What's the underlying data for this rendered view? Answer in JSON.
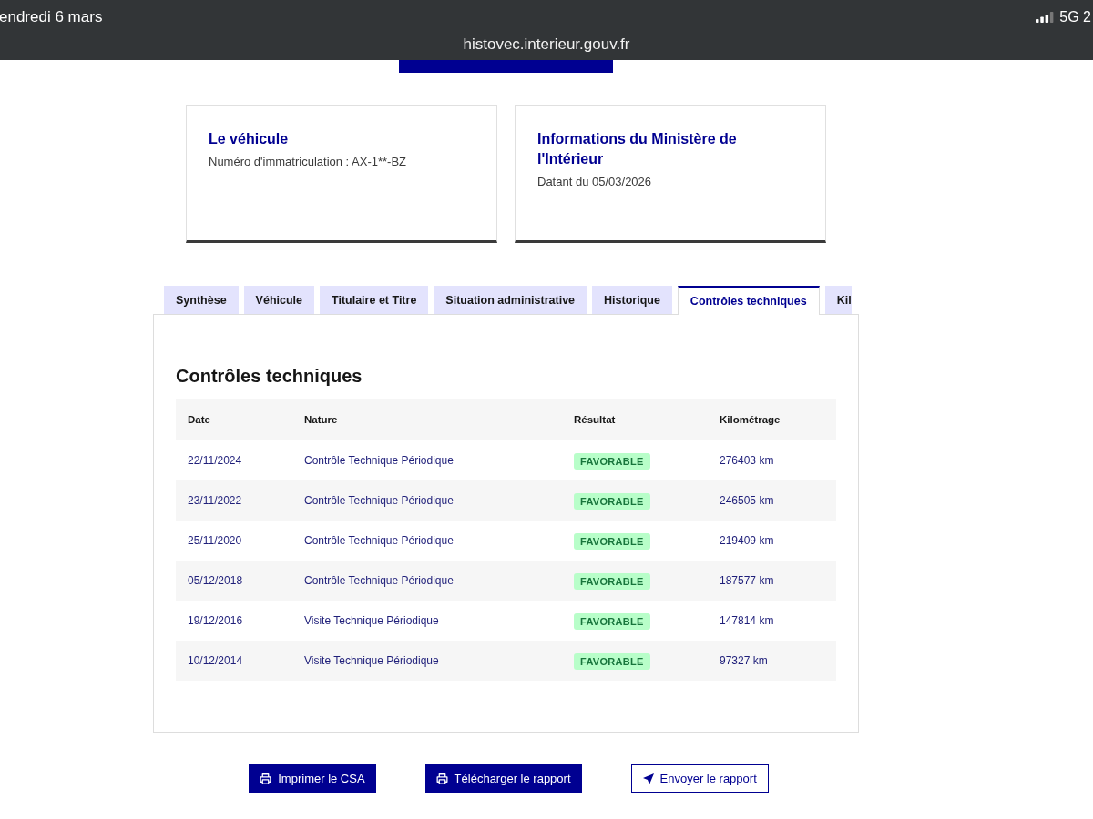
{
  "status_bar": {
    "date": "endredi 6 mars",
    "network": "5G 2",
    "url": "histovec.interieur.gouv.fr"
  },
  "cards": [
    {
      "title": "Le véhicule",
      "text": "Numéro d'immatriculation : AX-1**-BZ"
    },
    {
      "title": "Informations du Ministère de l'Intérieur",
      "text": "Datant du 05/03/2026"
    }
  ],
  "tabs": [
    {
      "label": "Synthèse",
      "selected": false
    },
    {
      "label": "Véhicule",
      "selected": false
    },
    {
      "label": "Titulaire et Titre",
      "selected": false
    },
    {
      "label": "Situation administrative",
      "selected": false
    },
    {
      "label": "Historique",
      "selected": false
    },
    {
      "label": "Contrôles techniques",
      "selected": true
    },
    {
      "label": "Kil",
      "selected": false
    }
  ],
  "panel": {
    "title": "Contrôles techniques",
    "table": {
      "columns": [
        "Date",
        "Nature",
        "Résultat",
        "Kilométrage"
      ],
      "rows": [
        {
          "date": "22/11/2024",
          "nature": "Contrôle Technique Périodique",
          "result": "FAVORABLE",
          "mileage": "276403 km"
        },
        {
          "date": "23/11/2022",
          "nature": "Contrôle Technique Périodique",
          "result": "FAVORABLE",
          "mileage": "246505 km"
        },
        {
          "date": "25/11/2020",
          "nature": "Contrôle Technique Périodique",
          "result": "FAVORABLE",
          "mileage": "219409 km"
        },
        {
          "date": "05/12/2018",
          "nature": "Contrôle Technique Périodique",
          "result": "FAVORABLE",
          "mileage": "187577 km"
        },
        {
          "date": "19/12/2016",
          "nature": "Visite Technique Périodique",
          "result": "FAVORABLE",
          "mileage": "147814 km"
        },
        {
          "date": "10/12/2014",
          "nature": "Visite Technique Périodique",
          "result": "FAVORABLE",
          "mileage": "97327 km"
        }
      ]
    }
  },
  "buttons": [
    {
      "label": "Imprimer le CSA",
      "kind": "primary"
    },
    {
      "label": "Télécharger le rapport",
      "kind": "primary"
    },
    {
      "label": "Envoyer le rapport",
      "kind": "secondary"
    }
  ]
}
